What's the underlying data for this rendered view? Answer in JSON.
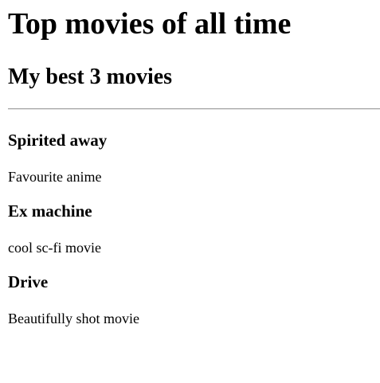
{
  "page": {
    "title": "Top movies of all time",
    "subtitle": "My best 3 movies"
  },
  "movies": [
    {
      "title": "Spirited away",
      "description": "Favourite anime"
    },
    {
      "title": "Ex machine",
      "description": "cool sc-fi movie"
    },
    {
      "title": "Drive",
      "description": "Beautifully shot movie"
    }
  ],
  "colors": {
    "background": "#ffffff",
    "text": "#000000",
    "divider": "#a0a0a0"
  }
}
